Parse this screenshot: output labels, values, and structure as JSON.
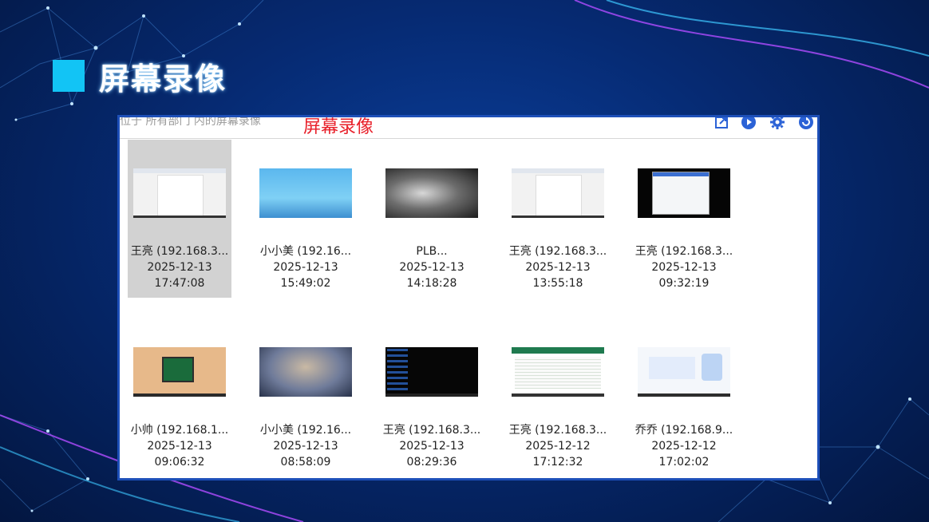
{
  "slide_title": "屏幕录像",
  "accent_color": "#12c4f5",
  "window": {
    "breadcrumb": "位于 所有部门 内的屏幕录像",
    "overlay_title": "屏幕录像",
    "toolbar_icons": [
      "export-icon",
      "play-icon",
      "gear-icon",
      "refresh-icon"
    ]
  },
  "recordings": [
    {
      "name": "王亮 (192.168.3...",
      "date": "2025-12-13",
      "time": "17:47:08",
      "selected": true
    },
    {
      "name": "小小美 (192.16...",
      "date": "2025-12-13",
      "time": "15:49:02",
      "selected": false
    },
    {
      "name": "PLB...",
      "date": "2025-12-13",
      "time": "14:18:28",
      "selected": false
    },
    {
      "name": "王亮 (192.168.3...",
      "date": "2025-12-13",
      "time": "13:55:18",
      "selected": false
    },
    {
      "name": "王亮 (192.168.3...",
      "date": "2025-12-13",
      "time": "09:32:19",
      "selected": false
    },
    {
      "name": "小帅 (192.168.1...",
      "date": "2025-12-13",
      "time": "09:06:32",
      "selected": false
    },
    {
      "name": "小小美 (192.16...",
      "date": "2025-12-13",
      "time": "08:58:09",
      "selected": false
    },
    {
      "name": "王亮 (192.168.3...",
      "date": "2025-12-13",
      "time": "08:29:36",
      "selected": false
    },
    {
      "name": "王亮 (192.168.3...",
      "date": "2025-12-12",
      "time": "17:12:32",
      "selected": false
    },
    {
      "name": "乔乔 (192.168.9...",
      "date": "2025-12-12",
      "time": "17:02:02",
      "selected": false
    }
  ]
}
